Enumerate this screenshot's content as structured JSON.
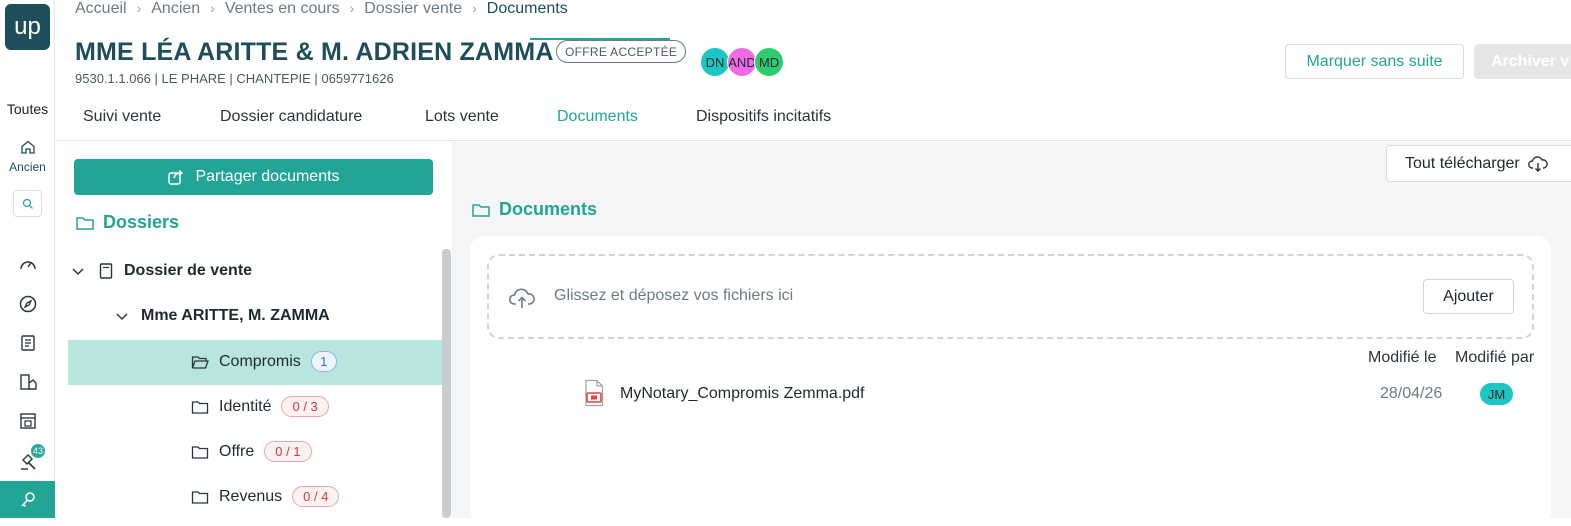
{
  "app": {
    "logo_text": "up"
  },
  "rail": {
    "toutes_label": "Toutes",
    "home_label": "Ancien",
    "notification_count": "43"
  },
  "breadcrumb": [
    "Accueil",
    "Ancien",
    "Ventes en cours",
    "Dossier vente",
    "Documents"
  ],
  "header": {
    "title": "MME LÉA ARITTE & M. ADRIEN ZAMMA",
    "status": "OFFRE ACCEPTÉE",
    "subtitle": "9530.1.1.066 | LE PHARE | CHANTEPIE | 0659771626",
    "avatars": [
      {
        "initials": "DN",
        "color": "#1cc6c2"
      },
      {
        "initials": "AND",
        "color": "#ef6ae6"
      },
      {
        "initials": "MD",
        "color": "#2ecc71"
      }
    ],
    "mark_button": "Marquer sans suite",
    "archive_button": "Archiver v"
  },
  "tabs": [
    {
      "label": "Suivi vente",
      "active": false
    },
    {
      "label": "Dossier candidature",
      "active": false
    },
    {
      "label": "Lots vente",
      "active": false
    },
    {
      "label": "Documents",
      "active": true
    },
    {
      "label": "Dispositifs incitatifs",
      "active": false
    }
  ],
  "left_panel": {
    "share_button": "Partager documents",
    "dossiers_title": "Dossiers",
    "root": "Dossier de vente",
    "group": "Mme ARITTE, M. ZAMMA",
    "folders": [
      {
        "name": "Compromis",
        "count": "1",
        "style": "blue",
        "selected": true
      },
      {
        "name": "Identité",
        "count": "0 / 3",
        "style": "red",
        "selected": false
      },
      {
        "name": "Offre",
        "count": "0 / 1",
        "style": "red",
        "selected": false
      },
      {
        "name": "Revenus",
        "count": "0 / 4",
        "style": "red",
        "selected": false
      }
    ]
  },
  "right_panel": {
    "download_all": "Tout télécharger",
    "title": "Documents",
    "dropzone_text": "Glissez et déposez vos fichiers ici",
    "add_button": "Ajouter",
    "col_modified_on": "Modifié le",
    "col_modified_by": "Modifié par",
    "files": [
      {
        "name": "MyNotary_Compromis Zemma.pdf",
        "date": "28/04/26",
        "user": "JM"
      }
    ]
  },
  "colors": {
    "accent": "#22a594",
    "primary_dark": "#1e4e5c"
  }
}
